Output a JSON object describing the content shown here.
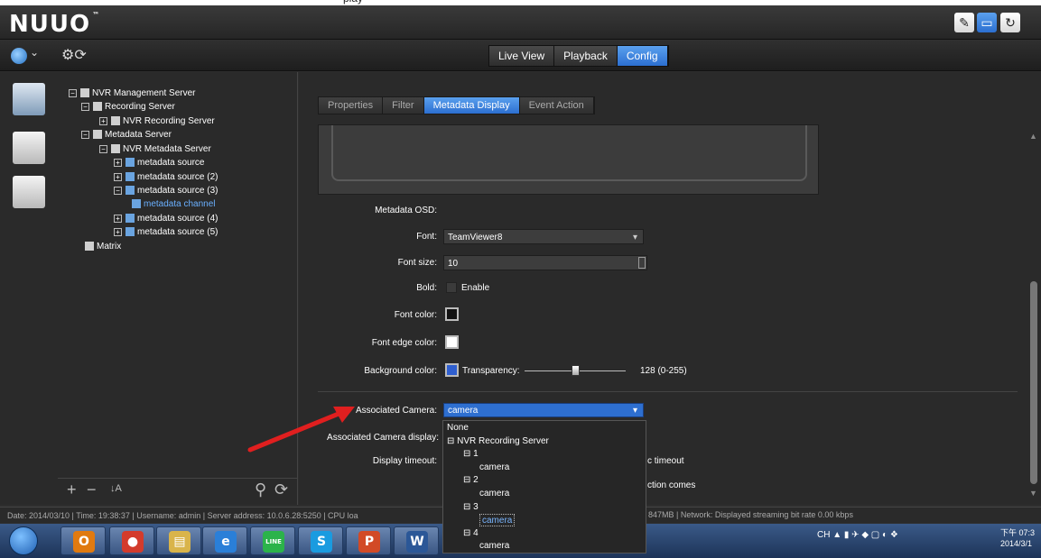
{
  "top_caption": "play",
  "app": {
    "logo": "NUUO",
    "tm": "™"
  },
  "mode_tabs": [
    {
      "label": "Live View"
    },
    {
      "label": "Playback"
    },
    {
      "label": "Config",
      "active": true
    }
  ],
  "tree": [
    {
      "label": "NVR Management Server",
      "exp": "−"
    },
    {
      "label": "Recording Server",
      "exp": "−"
    },
    {
      "label": "NVR Recording Server",
      "exp": "+"
    },
    {
      "label": "Metadata Server",
      "exp": "−"
    },
    {
      "label": "NVR Metadata Server",
      "exp": "−"
    },
    {
      "label": "metadata source",
      "exp": "+"
    },
    {
      "label": "metadata source (2)",
      "exp": "+"
    },
    {
      "label": "metadata source (3)",
      "exp": "−"
    },
    {
      "label": "metadata channel",
      "selected": true
    },
    {
      "label": "metadata source (4)",
      "exp": "+"
    },
    {
      "label": "metadata source (5)",
      "exp": "+"
    },
    {
      "label": "Matrix"
    }
  ],
  "tree_tools": {
    "add": "+",
    "remove": "−",
    "sort": "↓A",
    "search": "⚲",
    "gear": "⟳"
  },
  "sub_tabs": [
    {
      "label": "Properties"
    },
    {
      "label": "Filter"
    },
    {
      "label": "Metadata Display",
      "active": true
    },
    {
      "label": "Event Action"
    }
  ],
  "form": {
    "osd_label": "Metadata OSD:",
    "font_label": "Font:",
    "font_value": "TeamViewer8",
    "font_size_label": "Font size:",
    "font_size_value": "10",
    "bold_label": "Bold:",
    "bold_enable": "Enable",
    "font_color_label": "Font color:",
    "font_edge_color_label": "Font edge color:",
    "bg_color_label": "Background color:",
    "transparency_label": "Transparency:",
    "transparency_value": "128 (0-255)",
    "transparency_level": 128,
    "assoc_camera_label": "Associated Camera:",
    "assoc_camera_value": "camera",
    "assoc_display_label": "Associated Camera display:",
    "display_timeout_label": "Display timeout:",
    "timeout_text_1": "c timeout",
    "timeout_text_2": "ction comes"
  },
  "colors": {
    "font": "#111111",
    "edge": "#ffffff",
    "background": "#2f5fd0",
    "accent": "#2e6fd0"
  },
  "dropdown": [
    {
      "label": "None",
      "indent": 0
    },
    {
      "label": "⊟ NVR Recording Server",
      "indent": 0
    },
    {
      "label": "⊟ 1",
      "indent": 1
    },
    {
      "label": "camera",
      "indent": 2
    },
    {
      "label": "⊟ 2",
      "indent": 1
    },
    {
      "label": "camera",
      "indent": 2
    },
    {
      "label": "⊟ 3",
      "indent": 1
    },
    {
      "label": "camera",
      "indent": 2,
      "selected": true
    },
    {
      "label": "⊟ 4",
      "indent": 1
    },
    {
      "label": "camera",
      "indent": 2
    }
  ],
  "status": {
    "left": "Date: 2014/03/10  |  Time: 19:38:37  |  Username: admin  |  Server address: 10.0.6.28:5250  |  CPU loa",
    "right": "847MB  |  Network: Displayed streaming bit rate    0.00 kbps"
  },
  "taskbar": {
    "apps": [
      {
        "name": "outlook-app",
        "glyph": "O",
        "color": "#e07a10"
      },
      {
        "name": "chrome-app",
        "glyph": "●",
        "color": "#d33b2c"
      },
      {
        "name": "explorer-app",
        "glyph": "▤",
        "color": "#d9b44a"
      },
      {
        "name": "ie-app",
        "glyph": "e",
        "color": "#2a7fd8"
      },
      {
        "name": "line-app",
        "glyph": "LINE",
        "color": "#2bb34a"
      },
      {
        "name": "skype-app",
        "glyph": "S",
        "color": "#1a9be0"
      },
      {
        "name": "powerpoint-app",
        "glyph": "P",
        "color": "#d24a26"
      },
      {
        "name": "word-app",
        "glyph": "W",
        "color": "#2b5797"
      }
    ],
    "tray": "CH  ▲  ▮  ✈  ◆  ▢  ◐  ❖",
    "clock_time": "下午 07:3",
    "clock_date": "2014/3/1"
  }
}
